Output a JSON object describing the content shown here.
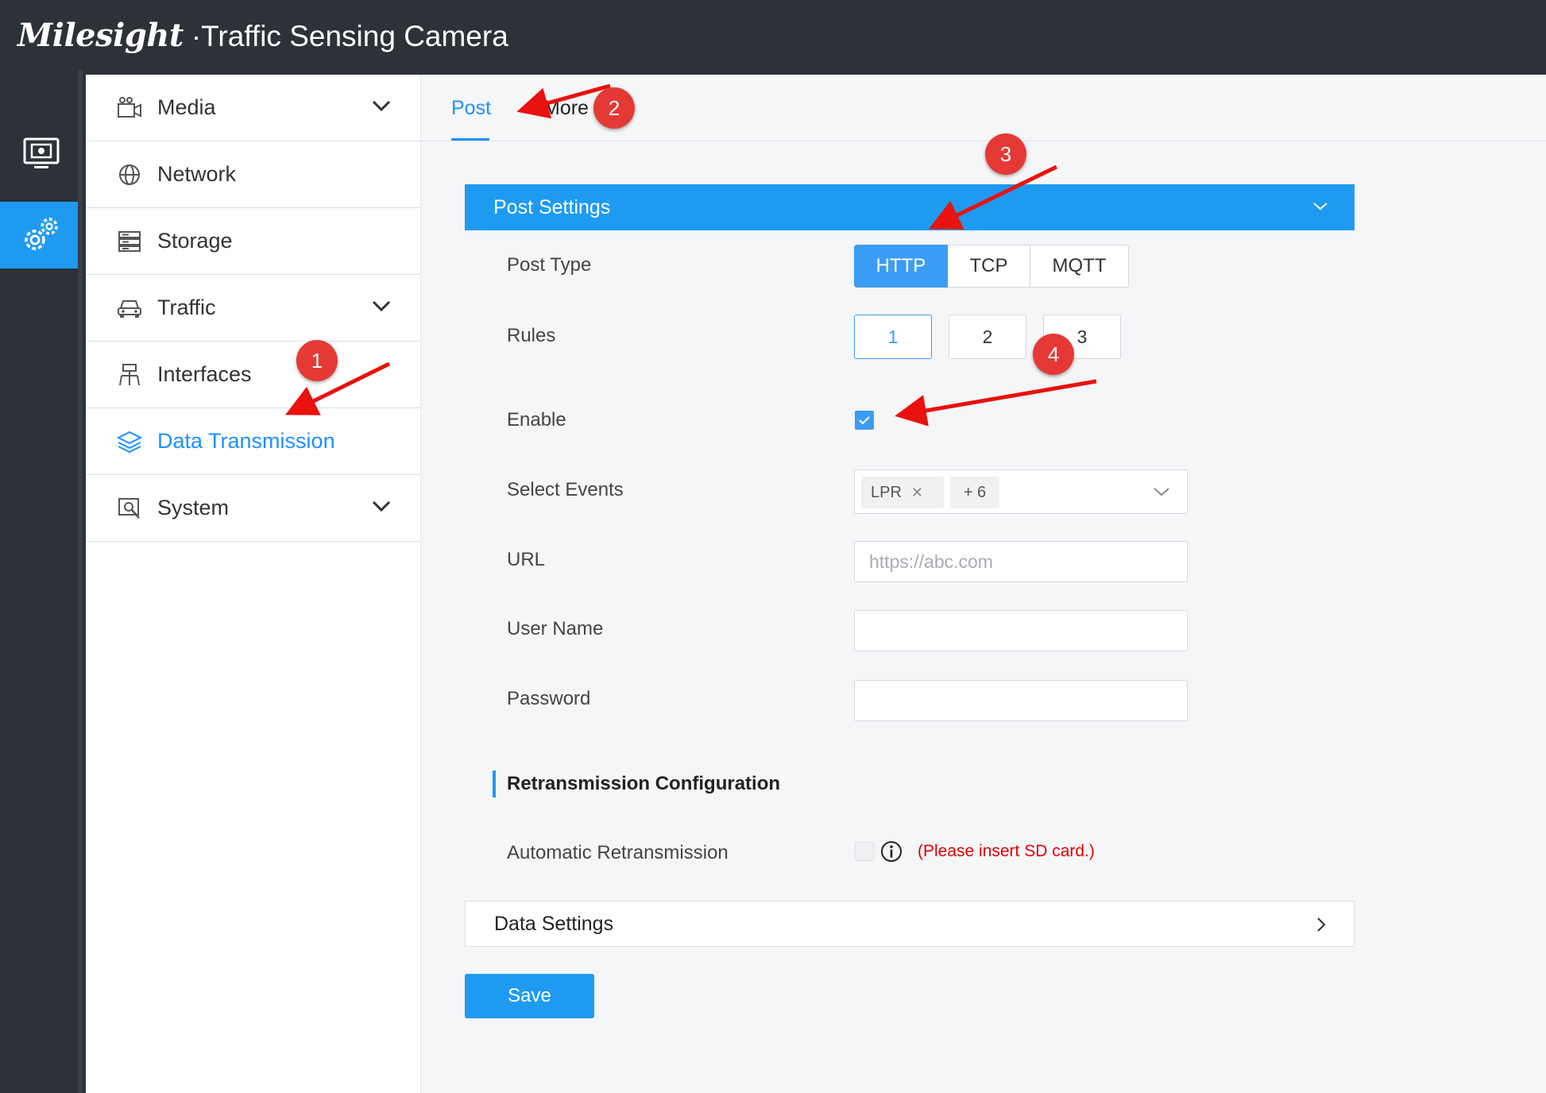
{
  "header": {
    "logo": "Milesight",
    "title": "·Traffic Sensing Camera"
  },
  "rail": {
    "items": [
      {
        "icon": "monitor-icon"
      },
      {
        "icon": "settings-gears-icon",
        "active": true
      }
    ]
  },
  "sidebar": {
    "items": [
      {
        "label": "Media",
        "icon": "media-camera-icon",
        "expandable": true
      },
      {
        "label": "Network",
        "icon": "globe-icon",
        "expandable": false
      },
      {
        "label": "Storage",
        "icon": "storage-icon",
        "expandable": false
      },
      {
        "label": "Traffic",
        "icon": "car-icon",
        "expandable": true
      },
      {
        "label": "Interfaces",
        "icon": "interfaces-icon",
        "expandable": false
      },
      {
        "label": "Data Transmission",
        "icon": "layers-icon",
        "active": true
      },
      {
        "label": "System",
        "icon": "system-icon",
        "expandable": true
      }
    ]
  },
  "tabs": [
    {
      "label": "Post",
      "active": true
    },
    {
      "label": "More"
    }
  ],
  "post_settings": {
    "title": "Post Settings",
    "post_type": {
      "label": "Post Type",
      "options": [
        "HTTP",
        "TCP",
        "MQTT"
      ],
      "selected": "HTTP"
    },
    "rules": {
      "label": "Rules",
      "options": [
        "1",
        "2",
        "3"
      ],
      "selected": "1"
    },
    "enable": {
      "label": "Enable",
      "checked": true
    },
    "select_events": {
      "label": "Select Events",
      "tag": "LPR",
      "more": "+ 6"
    },
    "url": {
      "label": "URL",
      "placeholder": "https://abc.com",
      "value": ""
    },
    "user_name": {
      "label": "User Name",
      "value": ""
    },
    "password": {
      "label": "Password",
      "value": ""
    },
    "retransmission": {
      "title": "Retransmission Configuration",
      "auto_label": "Automatic Retransmission",
      "checked": false,
      "warning": "(Please insert SD card.)"
    }
  },
  "data_settings": {
    "title": "Data Settings"
  },
  "save_label": "Save",
  "annotations": [
    "1",
    "2",
    "3",
    "4"
  ],
  "colors": {
    "accent": "#1e9bf0",
    "header_bg": "#2d3138",
    "annotation": "#e53935",
    "warning": "#e00000"
  }
}
